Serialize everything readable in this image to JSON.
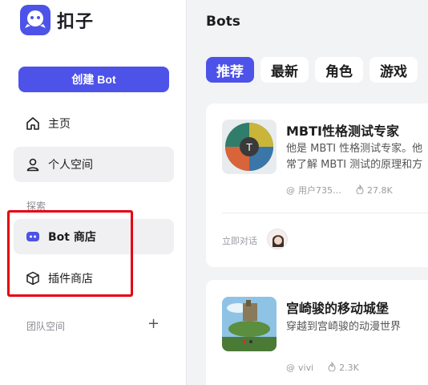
{
  "brand": {
    "name": "扣子",
    "accent": "#4d53e8"
  },
  "sidebar": {
    "create_button": "创建 Bot",
    "home": "主页",
    "personal": "个人空间",
    "explore_label": "探索",
    "bot_store": "Bot 商店",
    "plugin_store": "插件商店",
    "team_label": "团队空间",
    "add_icon": "+"
  },
  "main": {
    "title": "Bots",
    "tabs": [
      "推荐",
      "最新",
      "角色",
      "游戏"
    ],
    "cards": [
      {
        "name": "MBTI性格测试专家",
        "desc_line1": "他是 MBTI 性格测试专家。他",
        "desc_line2": "常了解 MBTI 测试的原理和方",
        "author": "用户735…",
        "count": "27.8K",
        "chat_label": "立即对话"
      },
      {
        "name": "宫崎骏的移动城堡",
        "desc_line1": "穿越到宫崎骏的动漫世界",
        "author": "vivi",
        "count": "2.3K"
      }
    ]
  },
  "colors": {
    "highlight": "#e6000f",
    "sidebar_bg": "#ffffff",
    "main_bg": "#f2f3f5"
  }
}
